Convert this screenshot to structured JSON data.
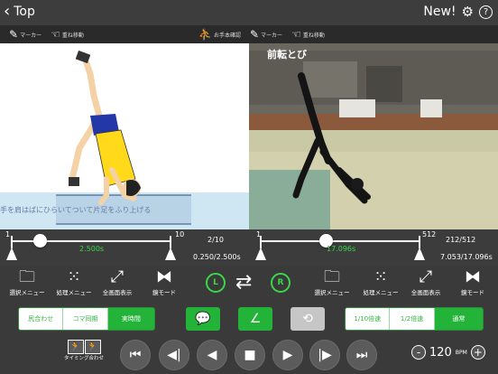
{
  "nav": {
    "back_label": "Top",
    "new_label": "New!",
    "help_label": "?"
  },
  "tools_left": [
    {
      "icon": "pencil-icon",
      "label": "マーカー"
    },
    {
      "icon": "overlay-move-icon",
      "label": "重ね移動"
    }
  ],
  "tools_right": [
    {
      "icon": "person-check-icon",
      "label": "お手本確認"
    },
    {
      "icon": "pencil-icon",
      "label": "マーカー"
    },
    {
      "icon": "overlay-move-icon",
      "label": "重ね移動"
    }
  ],
  "video_left": {
    "caption": "手を肩はばにひらいてついて片足をふり上げる"
  },
  "video_right": {
    "title": "前転とび"
  },
  "timeline_left": {
    "start": "1",
    "end": "10",
    "current_time": "2.500s",
    "frame_count": "2/10",
    "time_range": "0.250/2.500s",
    "position_fraction": 0.18
  },
  "timeline_right": {
    "start": "1",
    "end": "512",
    "current_time": "17.096s",
    "frame_count": "212/512",
    "time_range": "7.053/17.096s",
    "position_fraction": 0.41
  },
  "menu_left": [
    {
      "icon": "folder-icon",
      "label": "選択メニュー"
    },
    {
      "icon": "grid-icon",
      "label": "処理メニュー"
    },
    {
      "icon": "fullscreen-icon",
      "label": "全画面表示"
    },
    {
      "icon": "mirror-icon",
      "label": "鏡モード"
    }
  ],
  "menu_right": [
    {
      "icon": "folder-icon",
      "label": "選択メニュー"
    },
    {
      "icon": "grid-icon",
      "label": "処理メニュー"
    },
    {
      "icon": "fullscreen-icon",
      "label": "全画面表示"
    },
    {
      "icon": "mirror-icon",
      "label": "鏡モード"
    }
  ],
  "lr": {
    "left": "L",
    "right": "R"
  },
  "sync_segment": {
    "options": [
      "尻合わせ",
      "コマ同期",
      "実時間"
    ],
    "selected": "実時間"
  },
  "speed_segment": {
    "options": [
      "1/10倍速",
      "1/2倍速",
      "通常"
    ],
    "selected": "通常"
  },
  "timing": {
    "label": "タイミング合わせ"
  },
  "bpm": {
    "value": "120",
    "unit": "BPM",
    "minus": "-",
    "plus": "+"
  },
  "colors": {
    "accent_green": "#22b338",
    "time_green": "#39d64a"
  }
}
